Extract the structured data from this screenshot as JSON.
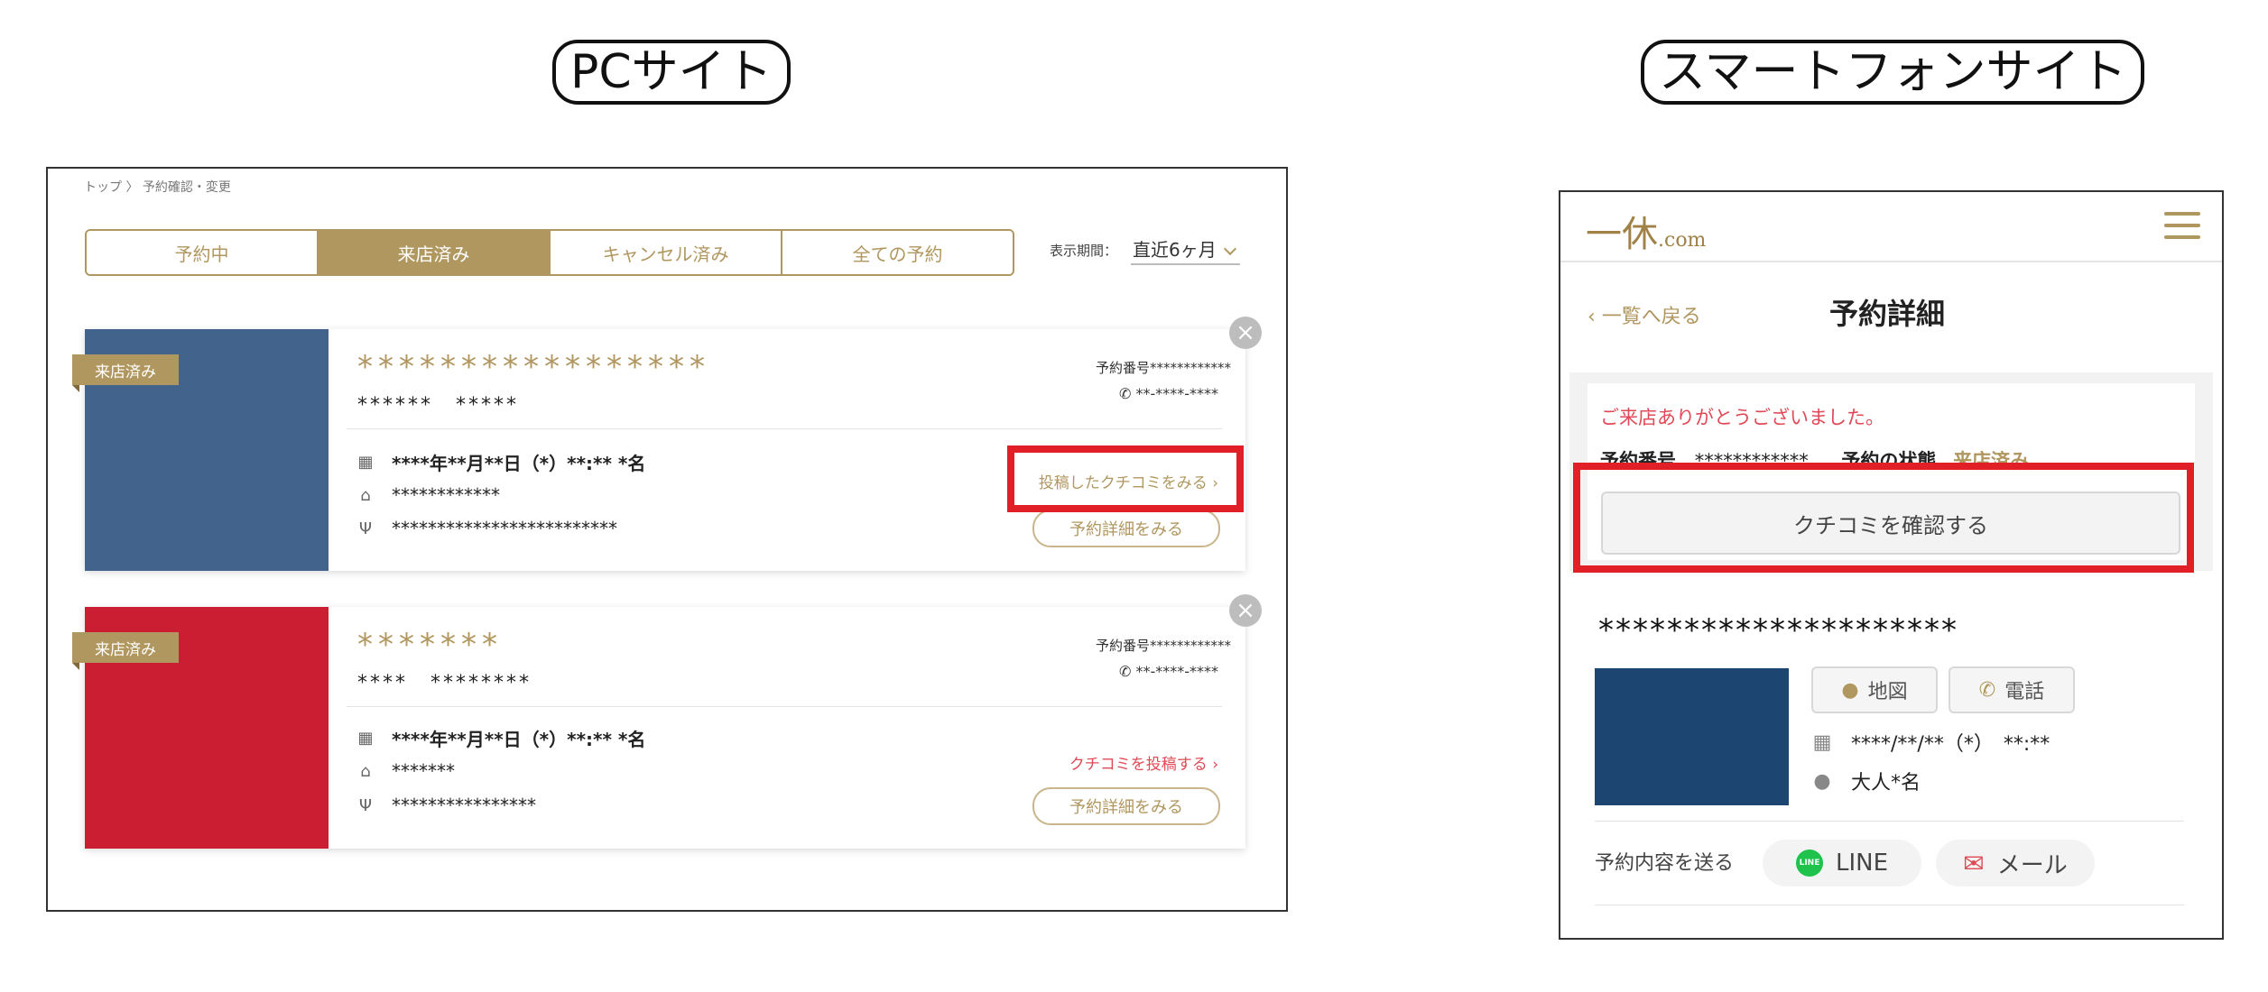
{
  "titles": {
    "pc": "PCサイト",
    "sp": "スマートフォンサイト"
  },
  "pc": {
    "breadcrumb": "トップ 〉 予約確認・変更",
    "tabs": [
      "予約中",
      "来店済み",
      "キャンセル済み",
      "全ての予約"
    ],
    "active_tab": "来店済み",
    "period_label": "表示期間：",
    "period_value": "直近6ヶ月",
    "cards": [
      {
        "color": "#41638c",
        "tag": "来店済み",
        "name": "*****************",
        "sub": "******　*****",
        "reservation_no": "予約番号************",
        "tel": "**-****-****",
        "datetime": "****年**月**日（*）**:** *名",
        "seat": "************",
        "course": "*************************",
        "link": "投稿したクチコミをみる ›",
        "detail_button": "予約詳細をみる"
      },
      {
        "color": "#cc1e33",
        "tag": "来店済み",
        "name": "*******",
        "sub": "****　********",
        "reservation_no": "予約番号************",
        "tel": "**-****-****",
        "datetime": "****年**月**日（*）**:** *名",
        "seat": "*******",
        "course": "****************",
        "link": "クチコミを投稿する ›",
        "detail_button": "予約詳細をみる"
      }
    ]
  },
  "sp": {
    "logo_main": "一休",
    "logo_suffix": ".com",
    "back": "一覧へ戻る",
    "title": "予約詳細",
    "thanks": "ご来店ありがとうございました。",
    "resno_label": "予約番号",
    "resno_value": "************",
    "status_label": "予約の状態",
    "status_value": "来店済み",
    "confirm_button": "クチコミを確認する",
    "restaurant_name": "*********************",
    "map_button": "地図",
    "tel_button": "電話",
    "datetime": "****/**/**（*）　**:**",
    "people": "大人*名",
    "send_label": "予約内容を送る",
    "line_button": "LINE",
    "mail_button": "メール"
  },
  "colors": {
    "gold": "#b0975f",
    "highlight": "#e01f26",
    "accent_red": "#e04a57"
  }
}
